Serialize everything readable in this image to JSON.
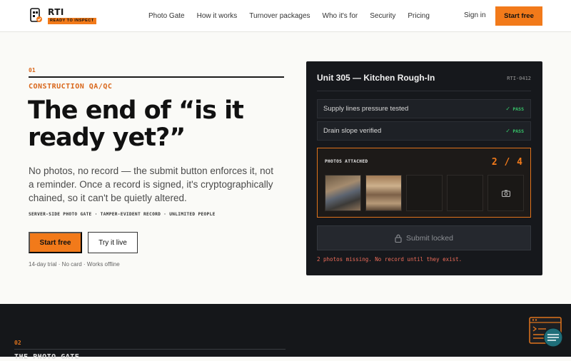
{
  "brand": {
    "name": "RTI",
    "tagline": "READY TO INSPECT"
  },
  "nav": {
    "items": [
      "Photo Gate",
      "How it works",
      "Turnover packages",
      "Who it's for",
      "Security",
      "Pricing"
    ],
    "signin": "Sign in",
    "start": "Start free"
  },
  "hero": {
    "section_number": "01",
    "eyebrow": "CONSTRUCTION QA/QC",
    "headline": "The end of “is it ready yet?”",
    "subtext": "No photos, no record — the submit button enforces it, not a reminder. Once a record is signed, it's cryptographically chained, so it can't be quietly altered.",
    "features": "SERVER-SIDE PHOTO GATE · TAMPER-EVIDENT RECORD · UNLIMITED PEOPLE",
    "primary_cta": "Start free",
    "secondary_cta": "Try it live",
    "note": "14-day trial · No card · Works offline"
  },
  "card": {
    "title": "Unit 305 — Kitchen Rough-In",
    "id": "RTI-0412",
    "checks": [
      {
        "label": "Supply lines pressure tested",
        "status": "PASS"
      },
      {
        "label": "Drain slope verified",
        "status": "PASS"
      }
    ],
    "photos_label": "PHOTOS ATTACHED",
    "photos_count": "2 / 4",
    "submit_label": "Submit locked",
    "missing_note": "2 photos missing. No record until they exist."
  },
  "next_section": {
    "number": "02",
    "eyebrow": "THE PHOTO GATE"
  },
  "colors": {
    "accent": "#f27a1a",
    "pass": "#37c46a",
    "error": "#ef6d5a",
    "dark": "#16181c"
  },
  "icons": [
    "logo-icon",
    "check-icon",
    "camera-icon",
    "lock-icon",
    "chat-widget-icon"
  ]
}
